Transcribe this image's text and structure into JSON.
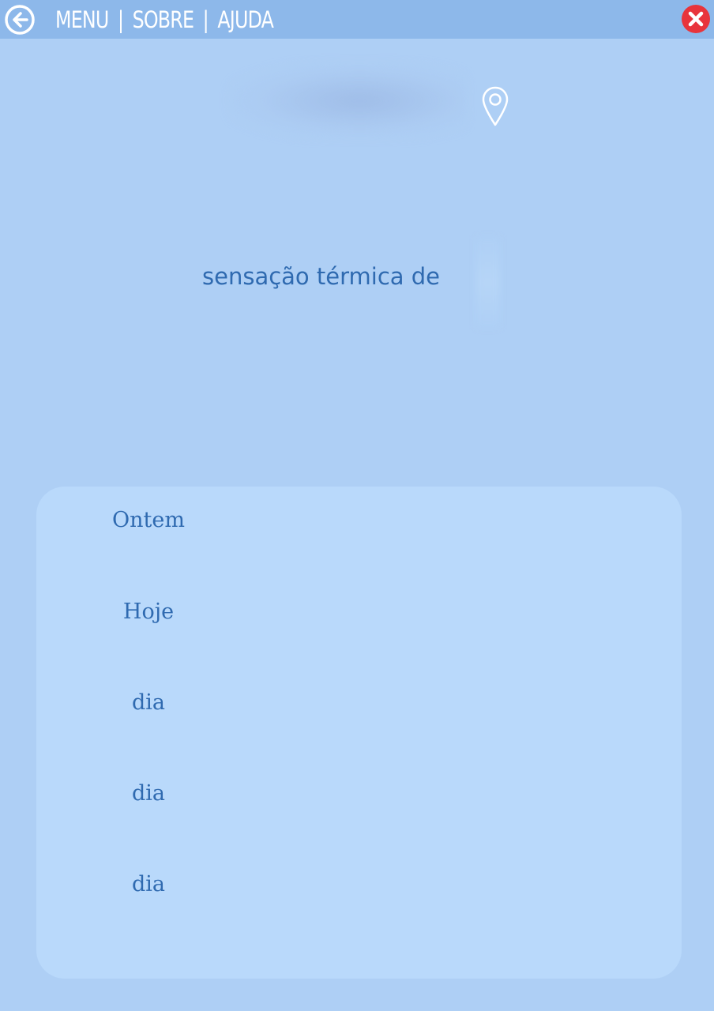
{
  "header": {
    "nav": [
      {
        "label": "MENU"
      },
      {
        "label": "SOBRE"
      },
      {
        "label": "AJUDA"
      }
    ],
    "separator": "|",
    "back_icon": "arrow-left-circle-icon",
    "close_icon": "close-x-circle-icon",
    "colors": {
      "bar": "#8db8ea",
      "close": "#e8343c"
    }
  },
  "weather": {
    "location_icon": "map-pin-icon",
    "feels_like_label": "sensação térmica de"
  },
  "forecast": {
    "days": [
      {
        "label": "Ontem"
      },
      {
        "label": "Hoje"
      },
      {
        "label": "dia"
      },
      {
        "label": "dia"
      },
      {
        "label": "dia"
      }
    ]
  },
  "colors": {
    "background": "#aecff5",
    "card": "#b9d9fb",
    "text": "#2f6ab0"
  }
}
